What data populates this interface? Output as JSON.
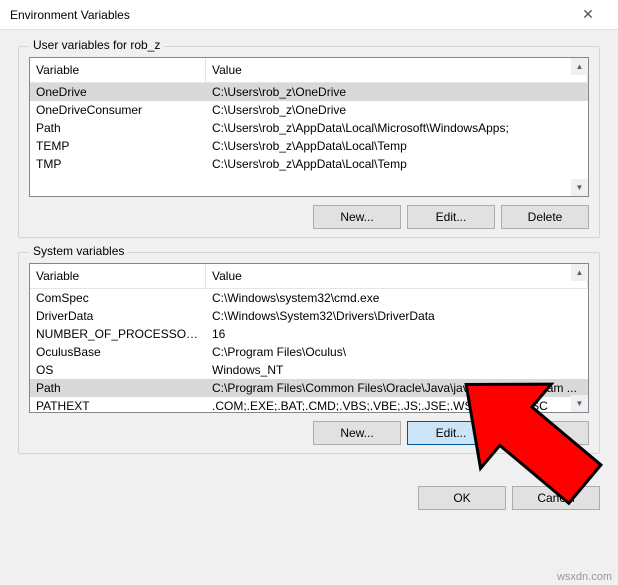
{
  "title": "Environment Variables",
  "user_section": {
    "label": "User variables for rob_z",
    "columns": {
      "var": "Variable",
      "val": "Value"
    },
    "rows": [
      {
        "var": "OneDrive",
        "val": "C:\\Users\\rob_z\\OneDrive",
        "selected": true
      },
      {
        "var": "OneDriveConsumer",
        "val": "C:\\Users\\rob_z\\OneDrive",
        "selected": false
      },
      {
        "var": "Path",
        "val": "C:\\Users\\rob_z\\AppData\\Local\\Microsoft\\WindowsApps;",
        "selected": false
      },
      {
        "var": "TEMP",
        "val": "C:\\Users\\rob_z\\AppData\\Local\\Temp",
        "selected": false
      },
      {
        "var": "TMP",
        "val": "C:\\Users\\rob_z\\AppData\\Local\\Temp",
        "selected": false
      }
    ],
    "buttons": {
      "new": "New...",
      "edit": "Edit...",
      "delete": "Delete"
    }
  },
  "system_section": {
    "label": "System variables",
    "columns": {
      "var": "Variable",
      "val": "Value"
    },
    "rows": [
      {
        "var": "ComSpec",
        "val": "C:\\Windows\\system32\\cmd.exe",
        "selected": false
      },
      {
        "var": "DriverData",
        "val": "C:\\Windows\\System32\\Drivers\\DriverData",
        "selected": false
      },
      {
        "var": "NUMBER_OF_PROCESSORS",
        "val": "16",
        "selected": false
      },
      {
        "var": "OculusBase",
        "val": "C:\\Program Files\\Oculus\\",
        "selected": false
      },
      {
        "var": "OS",
        "val": "Windows_NT",
        "selected": false
      },
      {
        "var": "Path",
        "val": "C:\\Program Files\\Common Files\\Oracle\\Java\\javapath;C:\\Program ...",
        "selected": true
      },
      {
        "var": "PATHEXT",
        "val": ".COM;.EXE;.BAT;.CMD;.VBS;.VBE;.JS;.JSE;.WSF;.WSH;.MSC",
        "selected": false
      }
    ],
    "buttons": {
      "new": "New...",
      "edit": "Edit...",
      "delete": "Delete"
    }
  },
  "dialog": {
    "ok": "OK",
    "cancel": "Cancel"
  },
  "watermark": "wsxdn.com"
}
